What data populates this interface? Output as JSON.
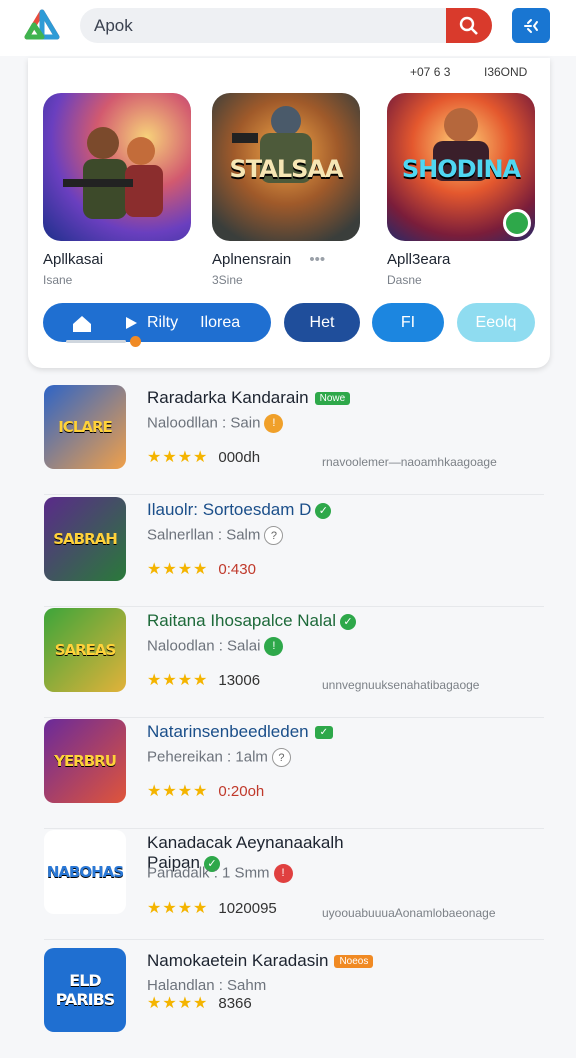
{
  "search": {
    "text": "Apok"
  },
  "featured": {
    "meta_left": "+07 6 3",
    "meta_right": "I36OND",
    "cards": [
      {
        "title": "",
        "name": "Apllkasai",
        "sub": "Isane"
      },
      {
        "title": "STALSAA",
        "name": "Aplnensrain",
        "sub": "3Sine",
        "extra": "•••"
      },
      {
        "title": "SHODINA",
        "name": "Apll3eara",
        "sub": "Dasne"
      }
    ],
    "chips": [
      "Rilty",
      "Ilorea",
      "Het",
      "FI",
      "Eeolq"
    ]
  },
  "items": [
    {
      "thumb": "ICLARE",
      "name": "Raradarka Kandarain",
      "badge": "Nowe",
      "sub": "Naloodllan :  Sain",
      "stars": "★★★★",
      "dl": "000dh",
      "tags": "rnavoolemer—naoamhkaagoage"
    },
    {
      "thumb": "SABRAH",
      "name": "Ilauolr: Sortoesdam D",
      "badge": "",
      "sub": "Salnerllan :  Salm",
      "stars": "★★★★",
      "dl": "0:430",
      "tags": ""
    },
    {
      "thumb": "SAREAS",
      "name": "Raitana Ihosapalce Nalal",
      "badge": "",
      "sub": "Naloodlan :  Salai",
      "stars": "★★★★",
      "dl": "13006",
      "tags": "unnvegnuuksenahatibagaoge"
    },
    {
      "thumb": "YERBRU",
      "name": "Natarinsenbeedleden",
      "badge": "",
      "sub": "Pehereikan :  1alm",
      "stars": "★★★★",
      "dl": "0:20oh",
      "tags": ""
    },
    {
      "thumb": "NABOHAS",
      "name": "Kanadacak Aeynanaakalh Paipan",
      "badge": "",
      "sub": "Panadalk :  1 Smm",
      "stars": "★★★★",
      "dl": "1020095",
      "tags": "uyoouabuuuaAonamlobaeonage"
    },
    {
      "thumb": "ELD PARIBS",
      "name": "Namokaetein Karadasin",
      "badge": "Noeos",
      "sub": "Halandlan :  Sahm",
      "stars": "★★★★",
      "dl": "8366",
      "tags": ""
    }
  ],
  "colors": {
    "accent_blue": "#1976d2",
    "navy": "#1f4e9b",
    "search_red": "#d93a2c",
    "green": "#2ea84a",
    "orange": "#f08a24"
  }
}
